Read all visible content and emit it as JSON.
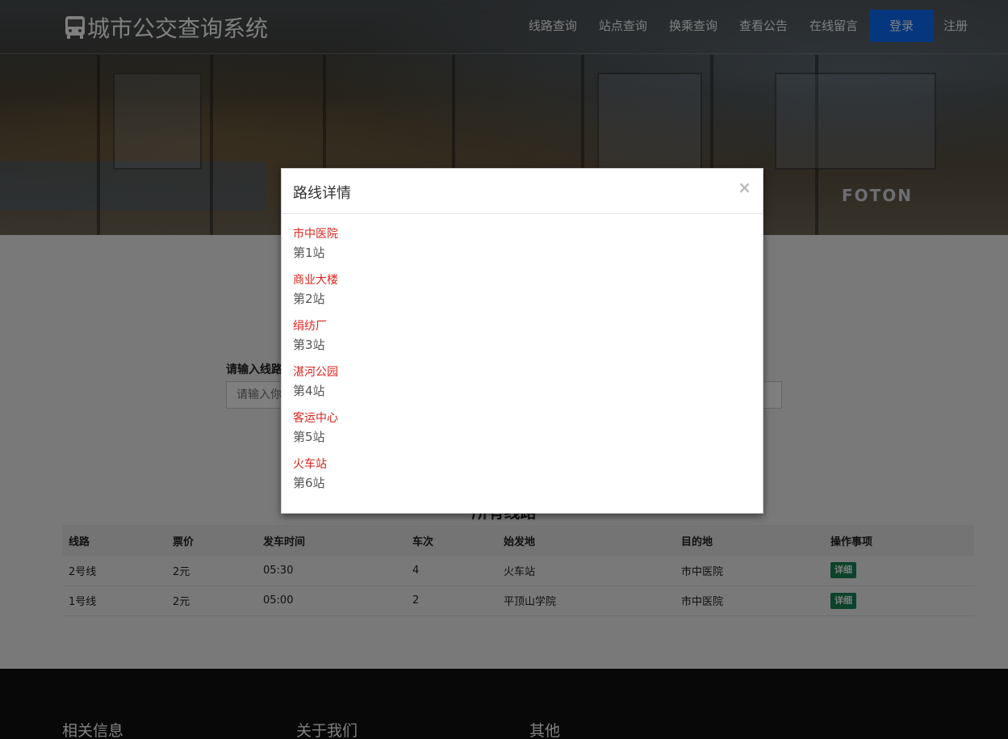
{
  "header": {
    "logo_text": "城市公交查询系统",
    "nav": [
      "线路查询",
      "站点查询",
      "换乘查询",
      "查看公告",
      "在线留言"
    ],
    "login_label": "登录",
    "register_label": "注册"
  },
  "hero": {
    "brand_mark": "FOTON"
  },
  "search": {
    "label": "请输入线路",
    "placeholder": "请输入你"
  },
  "section": {
    "title": "所有线路"
  },
  "table": {
    "headers": [
      "线路",
      "票价",
      "发车时间",
      "车次",
      "始发地",
      "目的地",
      "操作事项"
    ],
    "rows": [
      {
        "line": "2号线",
        "fare": "2元",
        "depart": "05:30",
        "trips": "4",
        "origin": "火车站",
        "dest": "市中医院",
        "action": "详细"
      },
      {
        "line": "1号线",
        "fare": "2元",
        "depart": "05:00",
        "trips": "2",
        "origin": "平顶山学院",
        "dest": "市中医院",
        "action": "详细"
      }
    ]
  },
  "footer": {
    "cols": [
      "相关信息",
      "关于我们",
      "其他"
    ]
  },
  "modal": {
    "title": "路线详情",
    "close": "×",
    "stops": [
      {
        "name": "市中医院",
        "order": "第1站"
      },
      {
        "name": "商业大楼",
        "order": "第2站"
      },
      {
        "name": "绢纺厂",
        "order": "第3站"
      },
      {
        "name": "湛河公园",
        "order": "第4站"
      },
      {
        "name": "客运中心",
        "order": "第5站"
      },
      {
        "name": "火车站",
        "order": "第6站"
      }
    ]
  },
  "colors": {
    "primary": "#0d6efd",
    "success": "#198754",
    "stop_name": "#d9251d"
  }
}
